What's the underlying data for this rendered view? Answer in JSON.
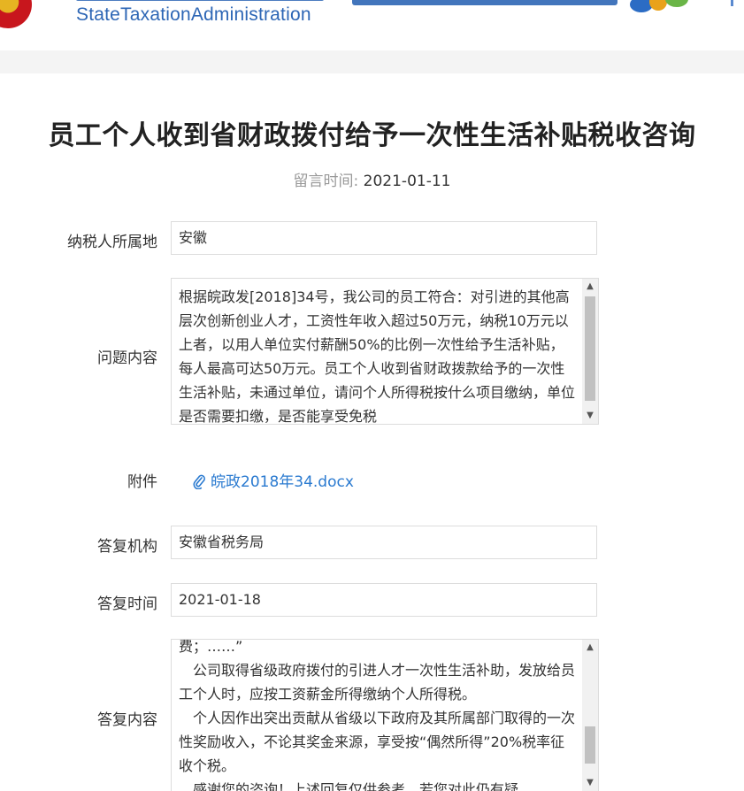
{
  "header": {
    "brand_en": "StateTaxationAdministration"
  },
  "page": {
    "title": "员工个人收到省财政拨付给予一次性生活补贴税收咨询",
    "message_time_label": "留言时间:",
    "message_time": "2021-01-11"
  },
  "form": {
    "location_label": "纳税人所属地",
    "location_value": "安徽",
    "question_label": "问题内容",
    "question_text": "根据皖政发[2018]34号，我公司的员工符合：对引进的其他高层次创新创业人才，工资性年收入超过50万元，纳税10万元以上者，以用人单位实付薪酬50%的比例一次性给予生活补贴，每人最高可达50万元。员工个人收到省财政拨款给予的一次性生活补贴，未通过单位，请问个人所得税按什么项目缴纳，单位是否需要扣缴，是否能享受免税",
    "attachment_label": "附件",
    "attachment_file": "皖政2018年34.docx",
    "reply_org_label": "答复机构",
    "reply_org_value": "安徽省税务局",
    "reply_time_label": "答复时间",
    "reply_time_value": "2021-01-18",
    "reply_content_label": "答复内容",
    "reply_paragraphs": [
      "费；……”",
      "　公司取得省级政府拨付的引进人才一次性生活补助，发放给员工个人时，应按工资薪金所得缴纳个人所得税。",
      "　个人因作出突出贡献从省级以下政府及其所属部门取得的一次性奖励收入，不论其奖金来源，享受按“偶然所得”20%税率征收个税。",
      "　感谢您的咨询！上述回复仅供参考，若您对此仍有疑"
    ]
  },
  "scrollbars": {
    "question_scroll_position": 0.0,
    "reply_scroll_position": 0.85
  },
  "colors": {
    "link": "#2a7ad0",
    "brand": "#2d66b5",
    "border": "#dcdcdc"
  }
}
